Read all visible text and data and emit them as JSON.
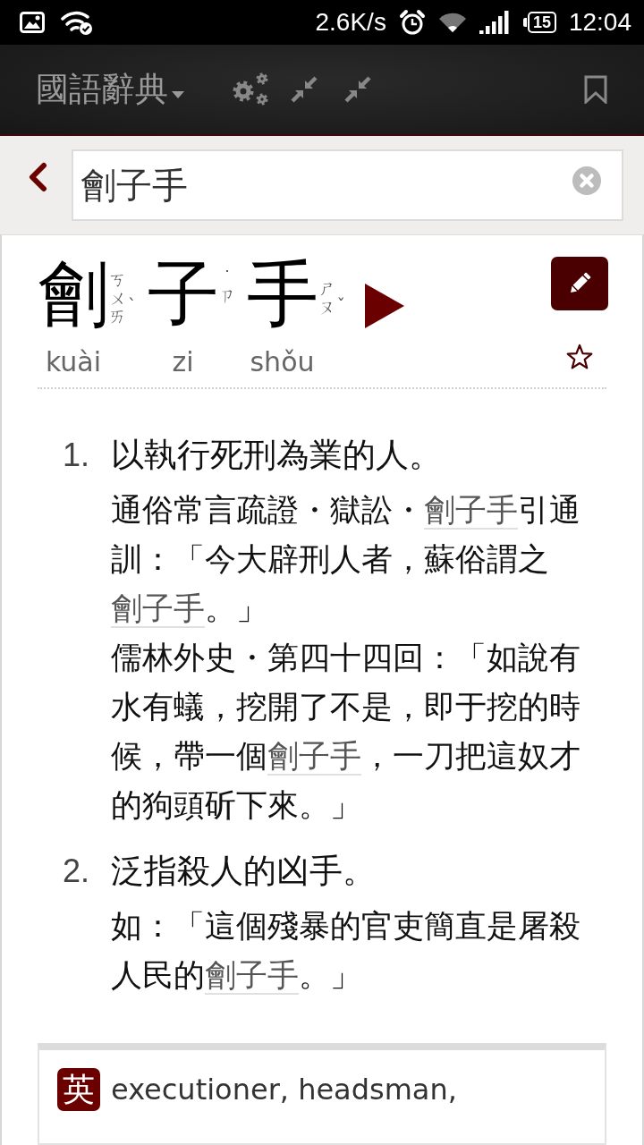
{
  "status_bar": {
    "net_speed": "2.6K/s",
    "battery": "15",
    "time": "12:04"
  },
  "toolbar": {
    "title": "國語辭典"
  },
  "search": {
    "value": "劊子手"
  },
  "entry": {
    "starred": false,
    "syllables": [
      {
        "char": "劊",
        "zhuyin": "ㄎㄨㄞ",
        "tone": "ˋ",
        "tone_above": false,
        "pinyin": "kuài"
      },
      {
        "char": "子",
        "zhuyin": "ㄗ",
        "tone": "˙",
        "tone_above": true,
        "pinyin": "zi"
      },
      {
        "char": "手",
        "zhuyin": "ㄕㄡ",
        "tone": "ˇ",
        "tone_above": false,
        "pinyin": "shǒu"
      }
    ],
    "definitions": [
      {
        "number": "1.",
        "text": "以執行死刑為業的人。",
        "examples": [
          [
            {
              "kind": "text",
              "text": "通俗常言疏證・獄訟・"
            },
            {
              "kind": "link",
              "text": "劊子手"
            },
            {
              "kind": "text",
              "text": "引通訓：「今大辟刑人者，蘇俗謂之"
            },
            {
              "kind": "link",
              "text": "劊子手"
            },
            {
              "kind": "text",
              "text": "。」"
            }
          ],
          [
            {
              "kind": "text",
              "text": "儒林外史・第四十四回：「如說有水有蟻，挖開了不是，即于挖的時候，帶一個"
            },
            {
              "kind": "link",
              "text": "劊子手"
            },
            {
              "kind": "text",
              "text": "，一刀把這奴才的狗頭斫下來。」"
            }
          ]
        ]
      },
      {
        "number": "2.",
        "text": "泛指殺人的凶手。",
        "examples": [
          [
            {
              "kind": "text",
              "text": "如：「這個殘暴的官吏簡直是屠殺人民的"
            },
            {
              "kind": "link",
              "text": "劊子手"
            },
            {
              "kind": "text",
              "text": "。」"
            }
          ]
        ]
      }
    ]
  },
  "translation": {
    "badge": "英",
    "text": "executioner, headsman,"
  }
}
